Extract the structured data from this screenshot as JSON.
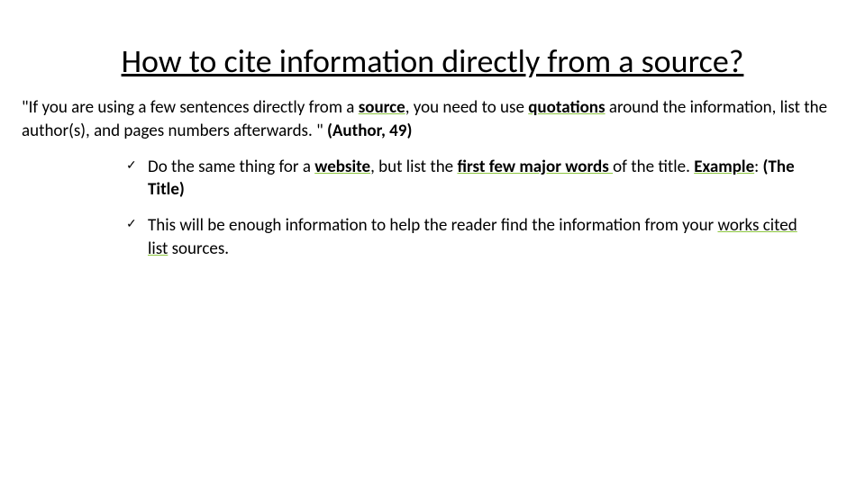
{
  "title": "How to cite information directly from a source?",
  "para": {
    "p1": "\"If you are using a few sentences directly from a ",
    "kw_source": "source",
    "p2": ", you need to use ",
    "kw_quotations": "quotations",
    "p3": " around the information, list the author(s), and pages numbers afterwards. \" ",
    "bold_tail": "(Author, 49)"
  },
  "bullets": {
    "b1": {
      "t1": "Do the same thing for a ",
      "kw_website": "website",
      "t2": ", but list the ",
      "kw_first": "first few major words ",
      "t3": "of the title. ",
      "kw_example": "Example",
      "t4": ": ",
      "bold_tail": "(The Title)"
    },
    "b2": {
      "t1": "This will be enough information to help the reader find the information from your ",
      "kw_works": "works cited list",
      "t2": " sources."
    }
  },
  "check_glyph": "✓"
}
